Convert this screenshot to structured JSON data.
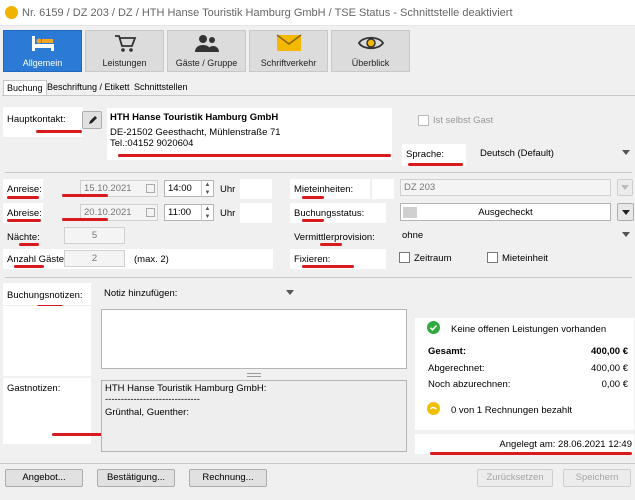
{
  "window": {
    "title": "Nr. 6159 / DZ 203 / DZ / HTH Hanse Touristik Hamburg GmbH / TSE Status - Schnittstelle deaktiviert"
  },
  "toolbar": [
    {
      "label": "Allgemein",
      "icon": "bed-icon",
      "active": true
    },
    {
      "label": "Leistungen",
      "icon": "cart-icon"
    },
    {
      "label": "Gäste / Gruppe",
      "icon": "people-icon"
    },
    {
      "label": "Schriftverkehr",
      "icon": "envelope-icon"
    },
    {
      "label": "Überblick",
      "icon": "eye-icon"
    }
  ],
  "tabs": [
    "Buchung",
    "Beschriftung / Etikett",
    "Schnittstellen"
  ],
  "contact": {
    "label": "Hauptkontakt:",
    "name": "HTH Hanse Touristik Hamburg GmbH",
    "address": "DE-21502 Geesthacht, Mühlenstraße 71",
    "phone": "Tel.:04152 9020604",
    "self_guest": "Ist selbst Gast",
    "language_label": "Sprache:",
    "language_value": "Deutsch (Default)"
  },
  "stay": {
    "arrival_label": "Anreise:",
    "arrival_date": "15.10.2021",
    "arrival_time": "14:00",
    "departure_label": "Abreise:",
    "departure_date": "20.10.2021",
    "departure_time": "11:00",
    "time_unit": "Uhr",
    "nights_label": "Nächte:",
    "nights_value": "5",
    "guests_label": "Anzahl Gäste:",
    "guests_value": "2",
    "guests_max": "(max. 2)"
  },
  "booking": {
    "units_label": "Mieteinheiten:",
    "units_value": "DZ 203",
    "status_label": "Buchungsstatus:",
    "status_value": "Ausgecheckt",
    "commission_label": "Vermittlerprovision:",
    "commission_value": "ohne",
    "fix_label": "Fixieren:",
    "fix_period": "Zeitraum",
    "fix_unit": "Mieteinheit"
  },
  "notes": {
    "booking_label": "Buchungsnotizen:",
    "add_note": "Notiz hinzufügen:",
    "guest_label": "Gastnotizen:",
    "guest_line1": "HTH Hanse Touristik Hamburg GmbH:",
    "guest_line2": "------------------------------",
    "guest_line3": "Grünthal, Guenther:"
  },
  "summary": {
    "status": "Keine offenen Leistungen vorhanden",
    "total_label": "Gesamt:",
    "total_value": "400,00 €",
    "billed_label": "Abgerechnet:",
    "billed_value": "400,00 €",
    "open_label": "Noch abzurechnen:",
    "open_value": "0,00 €",
    "invoices": "0 von 1 Rechnungen bezahlt",
    "created": "Angelegt am: 28.06.2021 12:49"
  },
  "buttons": {
    "offer": "Angebot...",
    "confirmation": "Bestätigung...",
    "invoice": "Rechnung...",
    "reset": "Zurücksetzen",
    "save": "Speichern"
  },
  "colors": {
    "accent": "#2b7bd6",
    "annotation": "#d8191e",
    "ok": "#2faa3c",
    "coin": "#f0c000"
  }
}
